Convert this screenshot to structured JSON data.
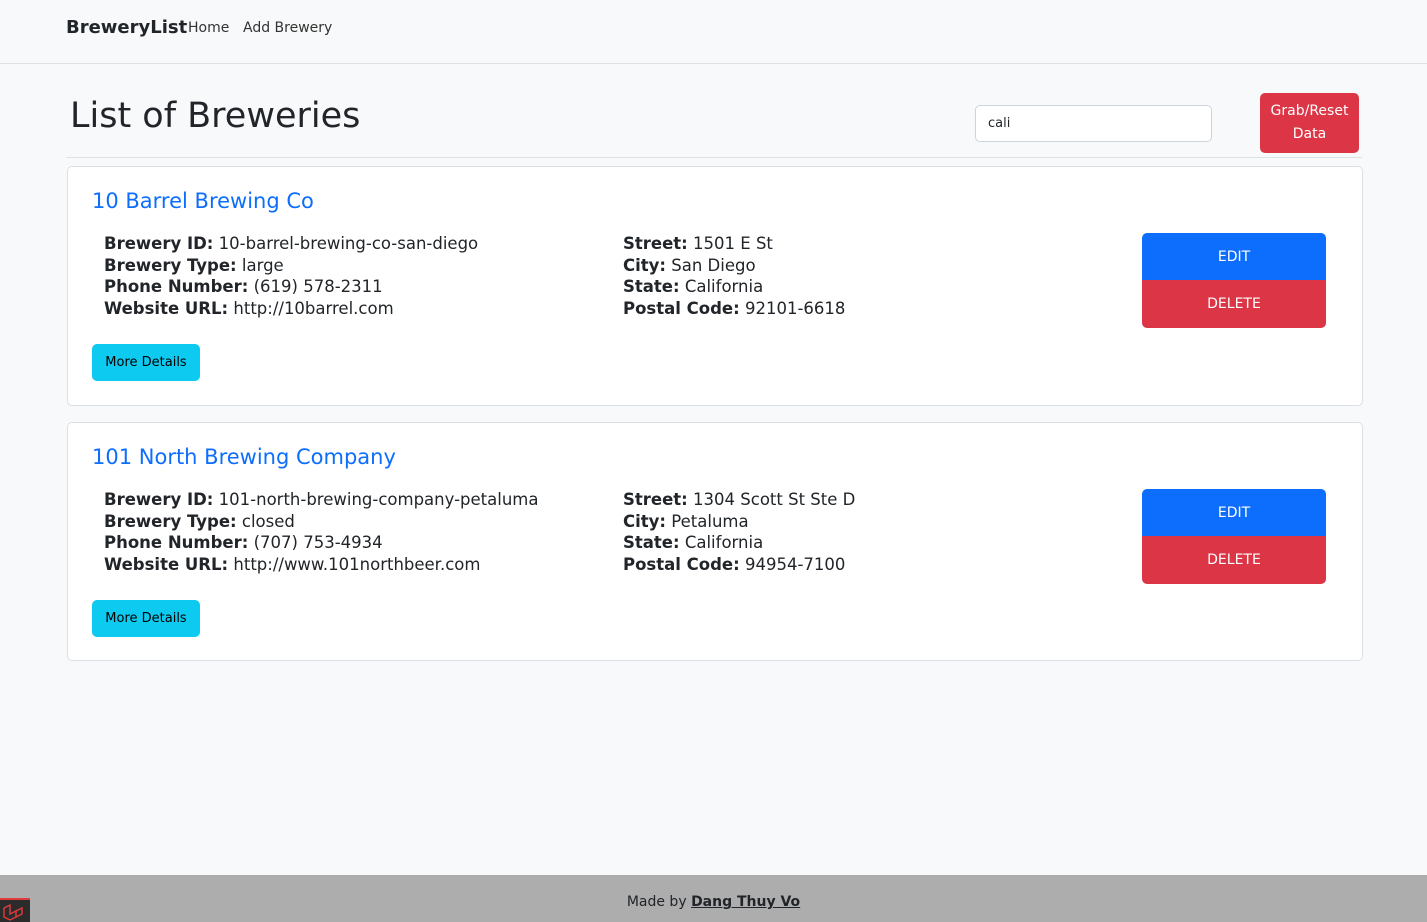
{
  "navbar": {
    "brand": "BreweryList",
    "links": [
      "Home",
      "Add Brewery"
    ]
  },
  "header": {
    "title": "List of Breweries",
    "search_value": "cali",
    "grab_button": "Grab/Reset Data"
  },
  "labels": {
    "id": "Brewery ID:",
    "type": "Brewery Type:",
    "phone": "Phone Number:",
    "website": "Website URL:",
    "street": "Street:",
    "city": "City:",
    "state": "State:",
    "postal": "Postal Code:",
    "more": "More Details",
    "edit": "EDIT",
    "delete": "DELETE"
  },
  "breweries": [
    {
      "name": "10 Barrel Brewing Co",
      "id": "10-barrel-brewing-co-san-diego",
      "type": "large",
      "phone": "(619) 578-2311",
      "website": "http://10barrel.com",
      "street": "1501 E St",
      "city": "San Diego",
      "state": "California",
      "postal": "92101-6618"
    },
    {
      "name": "101 North Brewing Company",
      "id": "101-north-brewing-company-petaluma",
      "type": "closed",
      "phone": "(707) 753-4934",
      "website": "http://www.101northbeer.com",
      "street": "1304 Scott St Ste D",
      "city": "Petaluma",
      "state": "California",
      "postal": "94954-7100"
    }
  ],
  "footer": {
    "prefix": "Made by",
    "author": "Dang Thuy Vo"
  },
  "colors": {
    "primary": "#0d6efd",
    "danger": "#dc3545",
    "info": "#0dcaf0",
    "footer_bg": "#adadad"
  },
  "icons": {
    "footer_logo": "laravel-logo-icon"
  }
}
